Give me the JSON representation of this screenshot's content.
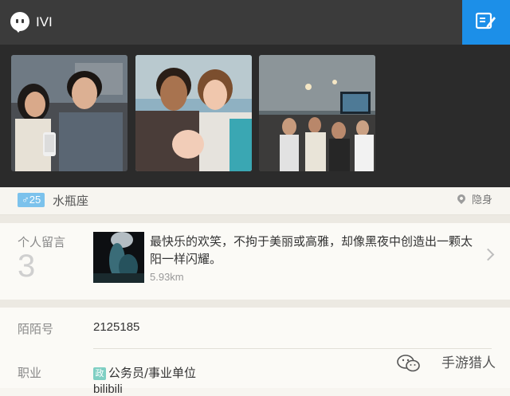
{
  "header": {
    "title": "IVI",
    "back_icon": "chat-bubble-icon",
    "edit_icon": "edit-profile-icon",
    "accent": "#1c8fe8"
  },
  "photos": [
    {
      "alt": "photo-1"
    },
    {
      "alt": "photo-2"
    },
    {
      "alt": "photo-3"
    }
  ],
  "profile": {
    "gender_symbol": "♂",
    "age": "25",
    "zodiac": "水瓶座",
    "location_status": "隐身",
    "badge_color": "#7cc2ec"
  },
  "messages": {
    "label": "个人留言",
    "count": "3",
    "text": "最快乐的欢笑，不拘于美丽或高雅，却像黑夜中创造出一颗太阳一样闪耀。",
    "distance": "5.93km"
  },
  "details": {
    "momo_label": "陌陌号",
    "momo_value": "2125185",
    "job_label": "职业",
    "job_tag": "政",
    "job_value": "公务员/事业单位",
    "extra_value": "bilibili"
  },
  "watermark": "手游猎人"
}
